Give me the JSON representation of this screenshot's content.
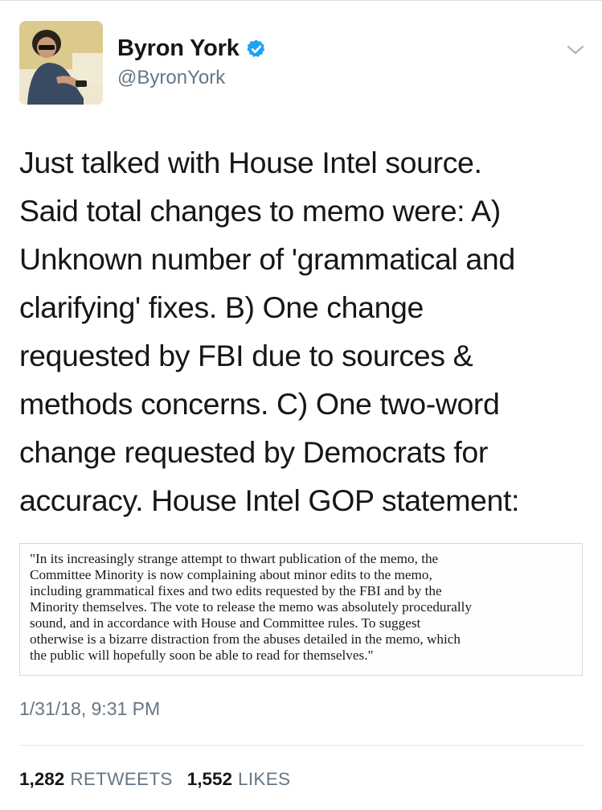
{
  "author": {
    "display_name": "Byron York",
    "handle": "@ByronYork",
    "verified": true
  },
  "tweet": {
    "text": "Just talked with House Intel source.\nSaid total changes to memo were: A)\nUnknown number of 'grammatical and\nclarifying' fixes. B) One change\nrequested by FBI due to sources &\nmethods concerns. C) One two-word\nchange requested by Democrats for\naccuracy. House Intel GOP statement:",
    "attached_statement": "\"In its increasingly strange attempt to thwart publication of the memo, the\nCommittee Minority is now complaining about minor edits to the memo,\nincluding grammatical fixes and two edits requested by the FBI and by the\nMinority themselves. The vote to release the memo was absolutely procedurally\nsound, and in accordance with House and Committee rules. To suggest\notherwise is a bizarre distraction from the abuses detailed in the memo, which\nthe public will hopefully soon be able to read for themselves.\"",
    "timestamp": "1/31/18, 9:31 PM"
  },
  "stats": {
    "retweets_count": "1,282",
    "retweets_label": "RETWEETS",
    "likes_count": "1,552",
    "likes_label": "LIKES"
  },
  "colors": {
    "text_primary": "#14171a",
    "text_secondary": "#657786",
    "verified_badge": "#1da1f2",
    "divider": "#e1e8ed"
  },
  "icons": {
    "verified": "verified-badge-icon",
    "menu": "chevron-down-icon"
  }
}
